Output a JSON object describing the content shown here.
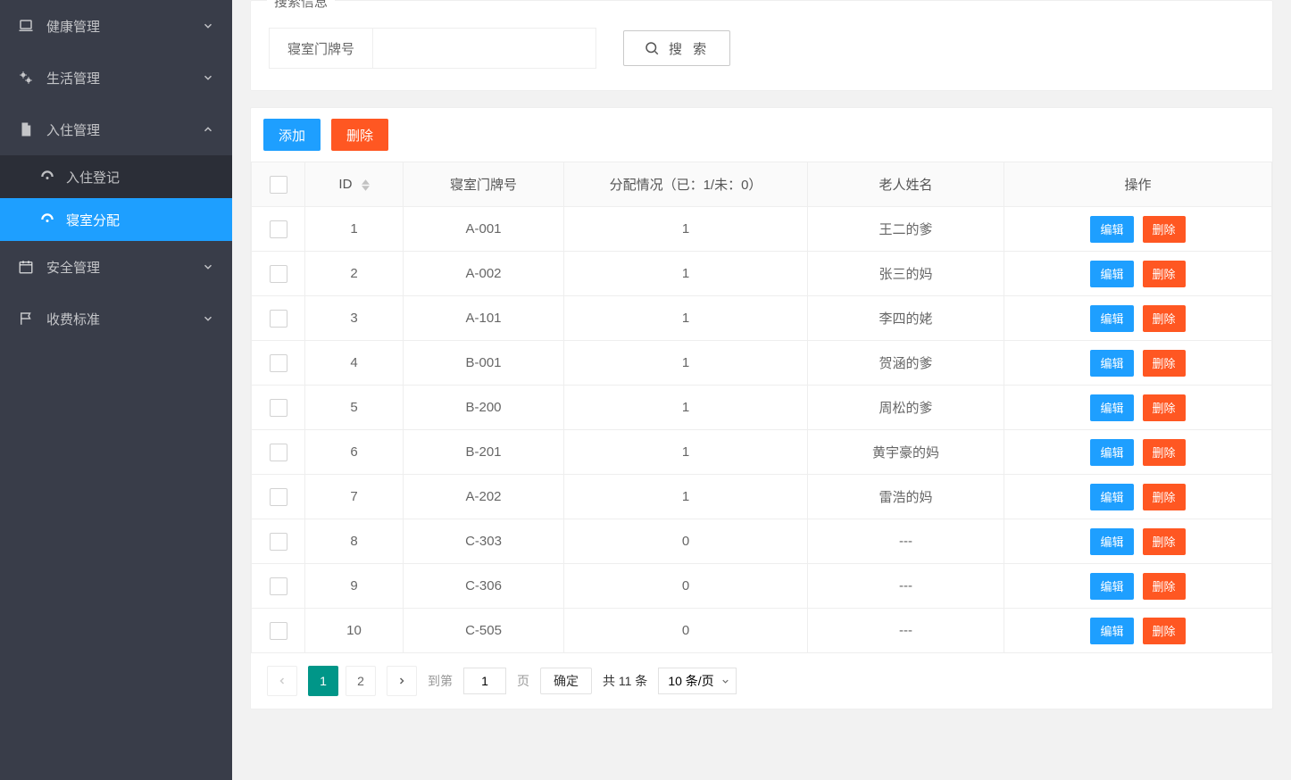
{
  "sidebar": {
    "items": [
      {
        "label": "健康管理",
        "icon": "laptop",
        "expanded": false
      },
      {
        "label": "生活管理",
        "icon": "cogs",
        "expanded": false
      },
      {
        "label": "入住管理",
        "icon": "file",
        "expanded": true,
        "children": [
          {
            "label": "入住登记",
            "icon": "dashboard",
            "active": false
          },
          {
            "label": "寝室分配",
            "icon": "dashboard",
            "active": true
          }
        ]
      },
      {
        "label": "安全管理",
        "icon": "calendar",
        "expanded": false
      },
      {
        "label": "收费标准",
        "icon": "flag",
        "expanded": false
      }
    ]
  },
  "search": {
    "panel_title": "搜索信息",
    "label": "寝室门牌号",
    "value": "",
    "button": "搜 索"
  },
  "toolbar": {
    "add": "添加",
    "delete": "删除"
  },
  "table": {
    "headers": {
      "id": "ID",
      "room": "寝室门牌号",
      "allocation": "分配情况（已：1/未：0）",
      "elder_name": "老人姓名",
      "ops": "操作"
    },
    "row_buttons": {
      "edit": "编辑",
      "delete": "删除"
    },
    "rows": [
      {
        "id": "1",
        "room": "A-001",
        "allocation": "1",
        "name": "王二的爹"
      },
      {
        "id": "2",
        "room": "A-002",
        "allocation": "1",
        "name": "张三的妈"
      },
      {
        "id": "3",
        "room": "A-101",
        "allocation": "1",
        "name": "李四的姥"
      },
      {
        "id": "4",
        "room": "B-001",
        "allocation": "1",
        "name": "贺涵的爹"
      },
      {
        "id": "5",
        "room": "B-200",
        "allocation": "1",
        "name": "周松的爹"
      },
      {
        "id": "6",
        "room": "B-201",
        "allocation": "1",
        "name": "黄宇豪的妈"
      },
      {
        "id": "7",
        "room": "A-202",
        "allocation": "1",
        "name": "雷浩的妈"
      },
      {
        "id": "8",
        "room": "C-303",
        "allocation": "0",
        "name": "---"
      },
      {
        "id": "9",
        "room": "C-306",
        "allocation": "0",
        "name": "---"
      },
      {
        "id": "10",
        "room": "C-505",
        "allocation": "0",
        "name": "---"
      }
    ]
  },
  "pagination": {
    "pages": [
      "1",
      "2"
    ],
    "active": "1",
    "goto_label": "到第",
    "goto_value": "1",
    "page_suffix": "页",
    "confirm": "确定",
    "total": "共 11 条",
    "per_page": "10 条/页"
  }
}
